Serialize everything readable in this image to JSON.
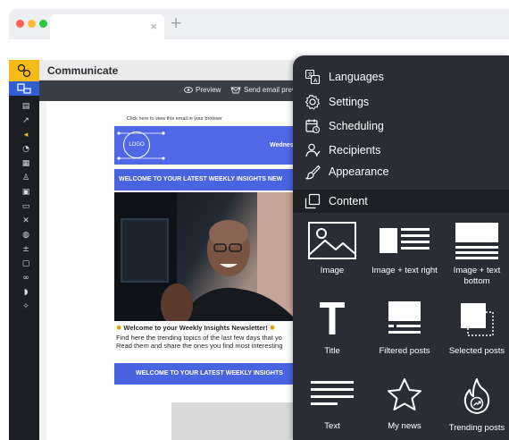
{
  "browser": {
    "tab_close": "×",
    "new_tab": "+",
    "dots": [
      "#ff5f57",
      "#febc2e",
      "#28c840"
    ]
  },
  "app": {
    "title": "Communicate"
  },
  "toolbar": {
    "preview_label": "Preview",
    "send_email_label": "Send email preview"
  },
  "email": {
    "view_link": "Click here to view this email in your browser",
    "logo_text": "LOGO",
    "header_date": "Wednes",
    "welcome_banner": "WELCOME TO YOUR LATEST WEEKLY INSIGHTS NEW",
    "newsletter_title": "Welcome to your Weekly Insights Newsletter!",
    "body_line1": "Find here the trending topics of the last few days that yo",
    "body_line2": "Read them and share the ones you find most interesting",
    "welcome_button": "WELCOME TO YOUR LATEST WEEKLY INSIGHTS"
  },
  "panel": {
    "menu": [
      {
        "label": "Languages",
        "icon": "languages-icon"
      },
      {
        "label": "Settings",
        "icon": "gear-icon"
      },
      {
        "label": "Scheduling",
        "icon": "calendar-icon"
      },
      {
        "label": "Recipients",
        "icon": "recipients-icon"
      },
      {
        "label": "Appearance",
        "icon": "brush-icon"
      },
      {
        "label": "Content",
        "icon": "content-icon",
        "active": true
      }
    ],
    "blocks": [
      {
        "label": "Image",
        "icon": "image-icon"
      },
      {
        "label": "Image + text right",
        "icon": "image-text-right-icon"
      },
      {
        "label": "Image + text bottom",
        "icon": "image-text-bottom-icon"
      },
      {
        "label": "Title",
        "icon": "title-icon"
      },
      {
        "label": "Filtered posts",
        "icon": "filtered-posts-icon"
      },
      {
        "label": "Selected posts",
        "icon": "selected-posts-icon"
      },
      {
        "label": "Text",
        "icon": "text-icon"
      },
      {
        "label": "My news",
        "icon": "star-icon"
      },
      {
        "label": "Trending posts",
        "icon": "trending-icon"
      }
    ]
  },
  "colors": {
    "accent": "#4a63e0",
    "logo_tile": "#f6bb19",
    "active_tile": "#2f5fd1",
    "panel_bg": "#2a2d33"
  }
}
